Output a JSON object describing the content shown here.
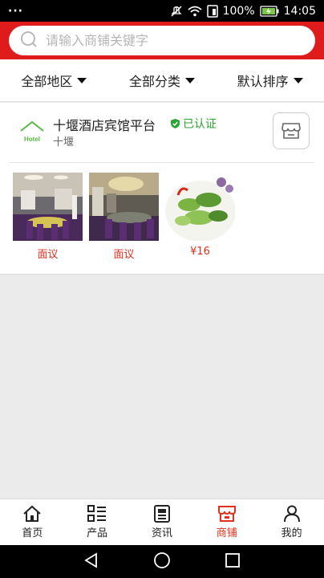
{
  "status_bar": {
    "menu_dots": "···",
    "battery_percent": "100%",
    "time": "14:05"
  },
  "search": {
    "placeholder": "请输入商铺关键字",
    "value": ""
  },
  "filters": [
    {
      "label": "全部地区"
    },
    {
      "label": "全部分类"
    },
    {
      "label": "默认排序"
    }
  ],
  "shop": {
    "name": "十堰酒店宾馆平台",
    "verified_label": "已认证",
    "city": "十堰",
    "logo_text": "Hotel",
    "products": [
      {
        "price": "面议",
        "image": "banquet-hall-photo"
      },
      {
        "price": "面议",
        "image": "dining-room-photo"
      },
      {
        "price": "¥16",
        "image": "vegetable-dish-photo"
      }
    ]
  },
  "bottom_nav": [
    {
      "label": "首页",
      "icon": "home-icon"
    },
    {
      "label": "产品",
      "icon": "product-list-icon"
    },
    {
      "label": "资讯",
      "icon": "news-icon"
    },
    {
      "label": "商铺",
      "icon": "store-icon",
      "active": true
    },
    {
      "label": "我的",
      "icon": "user-icon"
    }
  ],
  "colors": {
    "brand_red": "#e01b1b",
    "accent_red": "#e0301e",
    "verified_green": "#2aa534"
  }
}
